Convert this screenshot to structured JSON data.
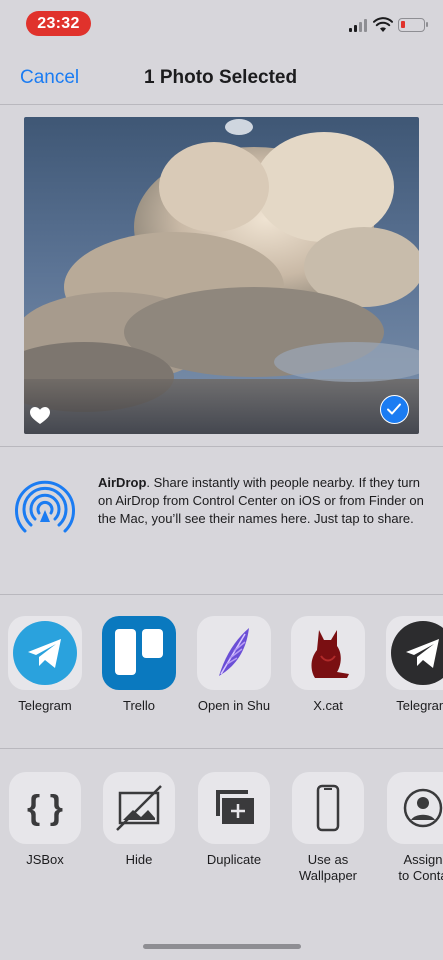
{
  "status": {
    "time": "23:32"
  },
  "nav": {
    "cancel_label": "Cancel",
    "title": "1 Photo Selected"
  },
  "airdrop": {
    "title": "AirDrop",
    "text": ". Share instantly with people nearby. If they turn on AirDrop from Control Center on iOS or from Finder on the Mac, you’ll see their names here. Just tap to share."
  },
  "apps": [
    {
      "label": "Telegram",
      "icon": "telegram-icon"
    },
    {
      "label": "Trello",
      "icon": "trello-icon"
    },
    {
      "label": "Open in Shu",
      "icon": "shu-feather-icon"
    },
    {
      "label": "X.cat",
      "icon": "xcat-icon"
    },
    {
      "label": "Telegram",
      "icon": "telegram-x-icon"
    }
  ],
  "actions": [
    {
      "label": "JSBox",
      "icon": "braces-icon"
    },
    {
      "label": "Hide",
      "icon": "hide-photo-icon"
    },
    {
      "label": "Duplicate",
      "icon": "duplicate-icon"
    },
    {
      "label": "Use as\nWallpaper",
      "icon": "phone-icon"
    },
    {
      "label": "Assign\nto Conta",
      "icon": "contact-icon"
    }
  ],
  "colors": {
    "accent": "#1b7cf2",
    "time_pill": "#e0322c",
    "sheet_bg": "#d7d6db"
  }
}
